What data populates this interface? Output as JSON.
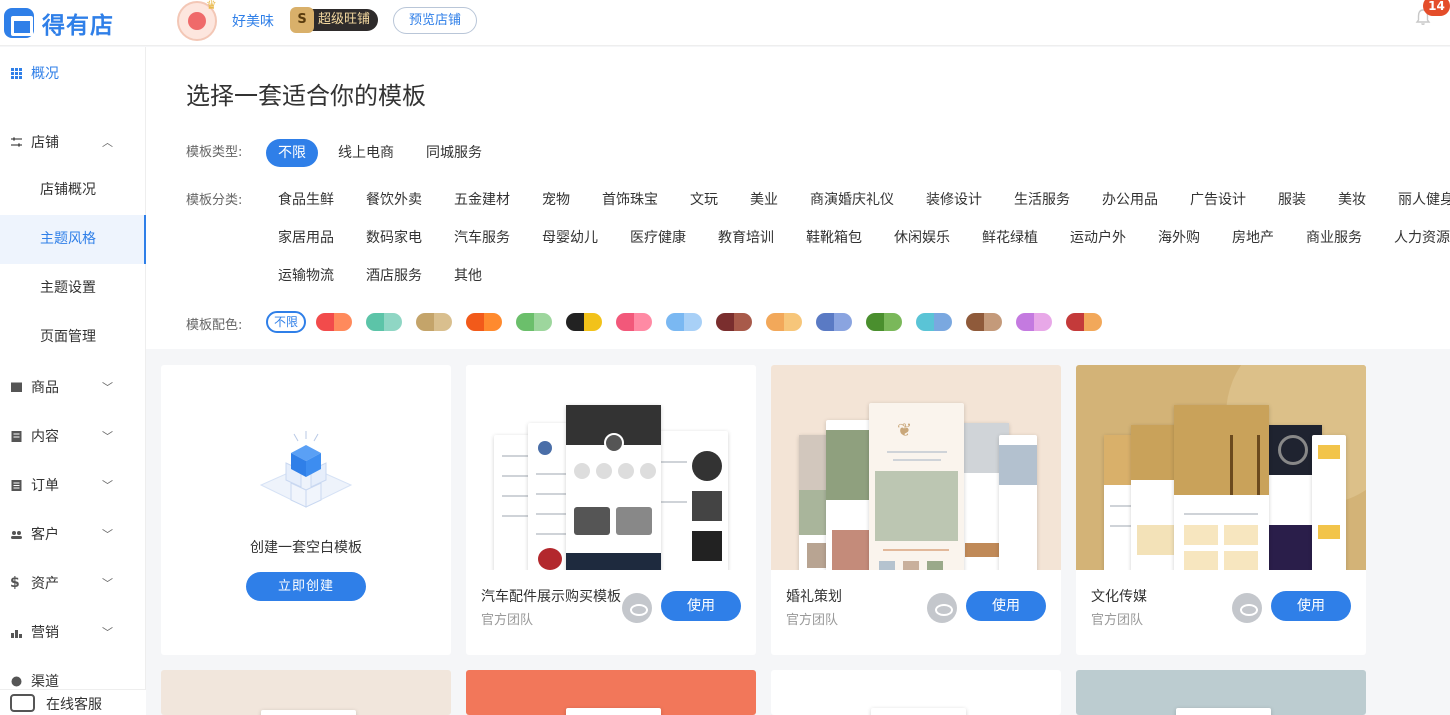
{
  "app": {
    "logo_text": "得有店",
    "shop_name": "好美味",
    "vip_badge": "超级旺铺",
    "vip_icon": "S",
    "preview_btn": "预览店铺",
    "notification_count": "14",
    "brand_color": "#2f7fe8"
  },
  "sidebar": {
    "overview": "概况",
    "store": "店铺",
    "store_sub": [
      "店铺概况",
      "主题风格",
      "主题设置",
      "页面管理"
    ],
    "items": [
      "商品",
      "内容",
      "订单",
      "客户",
      "资产",
      "营销",
      "渠道"
    ],
    "support": "在线客服"
  },
  "main": {
    "title": "选择一套适合你的模板",
    "type_label": "模板类型:",
    "types": [
      "不限",
      "线上电商",
      "同城服务"
    ],
    "category_label": "模板分类:",
    "categories_row1": [
      "食品生鲜",
      "餐饮外卖",
      "五金建材",
      "宠物",
      "首饰珠宝",
      "文玩",
      "美业",
      "商演婚庆礼仪",
      "装修设计",
      "生活服务",
      "办公用品",
      "广告设计",
      "服装",
      "美妆",
      "丽人健身"
    ],
    "categories_row2": [
      "家居用品",
      "数码家电",
      "汽车服务",
      "母婴幼儿",
      "医疗健康",
      "教育培训",
      "鞋靴箱包",
      "休闲娱乐",
      "鲜花绿植",
      "运动户外",
      "海外购",
      "房地产",
      "商业服务",
      "人力资源"
    ],
    "categories_row3": [
      "运输物流",
      "酒店服务",
      "其他"
    ],
    "color_label": "模板配色:",
    "color_none": "不限",
    "swatches": [
      [
        "#f24b4b",
        "#ff8a5c"
      ],
      [
        "#5cc4a8",
        "#8fd6c4"
      ],
      [
        "#c4a46a",
        "#d9bf8e"
      ],
      [
        "#f25a1a",
        "#ff8a2e"
      ],
      [
        "#6bbf6b",
        "#9dd69d"
      ],
      [
        "#222222",
        "#f2c21a"
      ],
      [
        "#f2587a",
        "#ff8aa4"
      ],
      [
        "#7ab8f2",
        "#a8d0f7"
      ],
      [
        "#7a2e2e",
        "#a85a4a"
      ],
      [
        "#f2a85a",
        "#f7c67a"
      ],
      [
        "#5a7ac4",
        "#8aa4e0"
      ],
      [
        "#4a8f2e",
        "#7ab85a"
      ],
      [
        "#5ac4d6",
        "#7aa8e0"
      ],
      [
        "#8f5a3a",
        "#c49a7a"
      ],
      [
        "#c47ae0",
        "#e8a8e8"
      ],
      [
        "#c43a3a",
        "#f2a85a"
      ]
    ]
  },
  "cards": {
    "blank": {
      "label": "创建一套空白模板",
      "button": "立即创建"
    },
    "templates": [
      {
        "title": "汽车配件展示购买模板",
        "sub": "官方团队",
        "use": "使用"
      },
      {
        "title": "婚礼策划",
        "sub": "官方团队",
        "use": "使用"
      },
      {
        "title": "文化传媒",
        "sub": "官方团队",
        "use": "使用"
      }
    ]
  }
}
